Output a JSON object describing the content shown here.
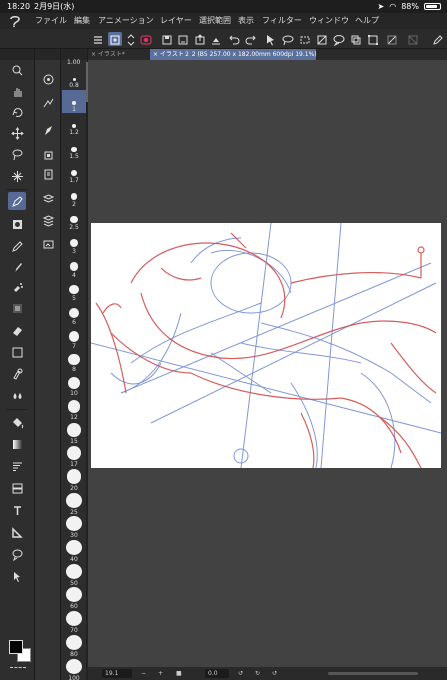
{
  "status": {
    "time": "18:20",
    "date": "2月9日(水)",
    "battery": "88%",
    "battery_level": 0.88
  },
  "menu": [
    "ファイル",
    "編集",
    "アニメーション",
    "レイヤー",
    "選択範囲",
    "表示",
    "フィルター",
    "ウィンドウ",
    "ヘルプ"
  ],
  "tabs": [
    {
      "label": "× イラスト*"
    },
    {
      "label": "× イラスト２ 2 (B5 257.00 x 182.00mm 600dpi 19.1%)"
    }
  ],
  "brush_sizes": [
    "0.8",
    "1",
    "1.2",
    "1.5",
    "1.7",
    "2",
    "2.5",
    "3",
    "4",
    "5",
    "6",
    "7",
    "8",
    "10",
    "12",
    "15",
    "17",
    "20",
    "25",
    "30",
    "40",
    "50",
    "60",
    "70",
    "80",
    "100"
  ],
  "brush_size_current": "1.00",
  "brush_size_selected": "1",
  "bottom": {
    "zoom": "19.1",
    "minus": "−",
    "plus": "+",
    "angle": "0.0"
  },
  "colors": {
    "accent": "#5b6f9b",
    "main_color": "#000000",
    "sub_color": "#ffffff"
  },
  "icons": {
    "tools": [
      "zoom-icon",
      "hand-icon",
      "rotate-icon",
      "move-icon",
      "lasso-icon",
      "eyedropper-sparkle-icon",
      "pen-icon",
      "fill-dot-icon",
      "pencil-icon",
      "brush-icon",
      "airbrush-icon",
      "decoration-icon",
      "eraser-icon",
      "square-icon",
      "blend-icon",
      "drops-icon",
      "fill-bucket-icon",
      "gradient-icon",
      "lines-icon",
      "frame-icon",
      "text-icon",
      "ruler-icon",
      "balloon-icon",
      "select-arrow-icon"
    ]
  }
}
